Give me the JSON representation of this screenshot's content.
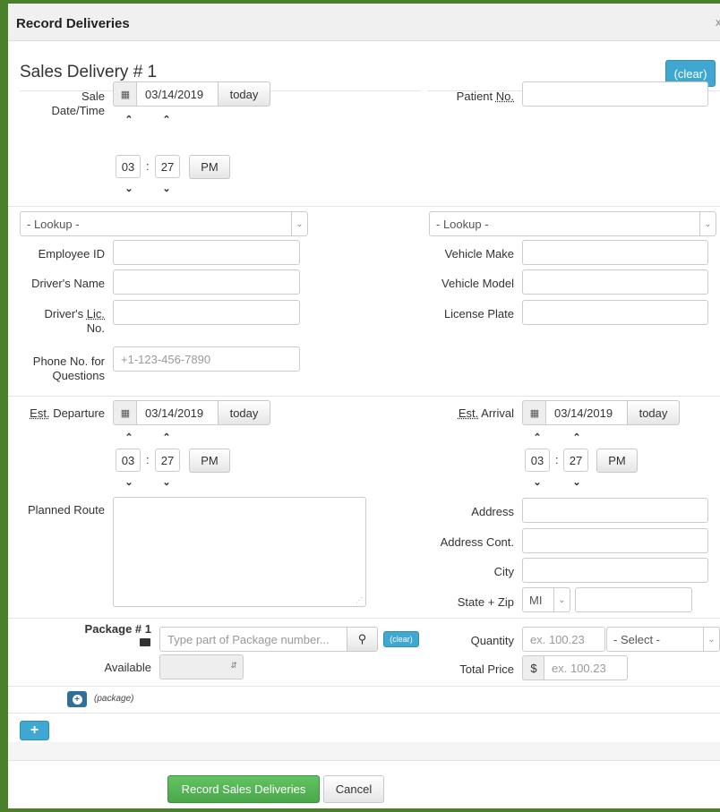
{
  "modal": {
    "title": "Record Deliveries",
    "close_glyph": "x"
  },
  "delivery": {
    "heading": "Sales Delivery # 1",
    "clear_label": "(clear)"
  },
  "sale": {
    "label": "Sale Date/Time",
    "date": "03/14/2019",
    "today_label": "today",
    "hour": "03",
    "minute": "27",
    "ampm": "PM"
  },
  "patient": {
    "label_pre": "Patient ",
    "label_abbr": "No.",
    "value": ""
  },
  "lookup": {
    "left": "- Lookup -",
    "right": "- Lookup -"
  },
  "employee": {
    "id_label": "Employee ID",
    "driver_name_label": "Driver's Name",
    "driver_lic_pre": "Driver's ",
    "driver_lic_abbr": "Lic.",
    "driver_lic_post": "No.",
    "phone_label_1": "Phone No. for",
    "phone_label_2": "Questions",
    "phone_placeholder": "+1-123-456-7890"
  },
  "vehicle": {
    "make_label": "Vehicle Make",
    "model_label": "Vehicle Model",
    "plate_label": "License Plate"
  },
  "departure": {
    "label_abbr": "Est.",
    "label_post": " Departure",
    "date": "03/14/2019",
    "today_label": "today",
    "hour": "03",
    "minute": "27",
    "ampm": "PM"
  },
  "arrival": {
    "label_abbr": "Est.",
    "label_post": " Arrival",
    "date": "03/14/2019",
    "today_label": "today",
    "hour": "03",
    "minute": "27",
    "ampm": "PM"
  },
  "route": {
    "label": "Planned Route"
  },
  "address": {
    "address_label": "Address",
    "address_cont_label": "Address Cont.",
    "city_label": "City",
    "state_zip_label": "State + Zip",
    "state_value": "MI"
  },
  "package": {
    "label": "Package # 1",
    "placeholder": "Type part of Package number...",
    "clear_label": "(clear)",
    "available_label": "Available",
    "add_label": "(package)"
  },
  "pricing": {
    "quantity_label": "Quantity",
    "quantity_placeholder": "ex. 100.23",
    "unit_select": "- Select -",
    "total_label": "Total Price",
    "currency": "$",
    "total_placeholder": "ex. 100.23"
  },
  "footer": {
    "record_label": "Record Sales Deliveries",
    "cancel_label": "Cancel"
  },
  "colors": {
    "frame": "#4a7f2c",
    "primary": "#3ea7d2",
    "success": "#5cb85c"
  }
}
